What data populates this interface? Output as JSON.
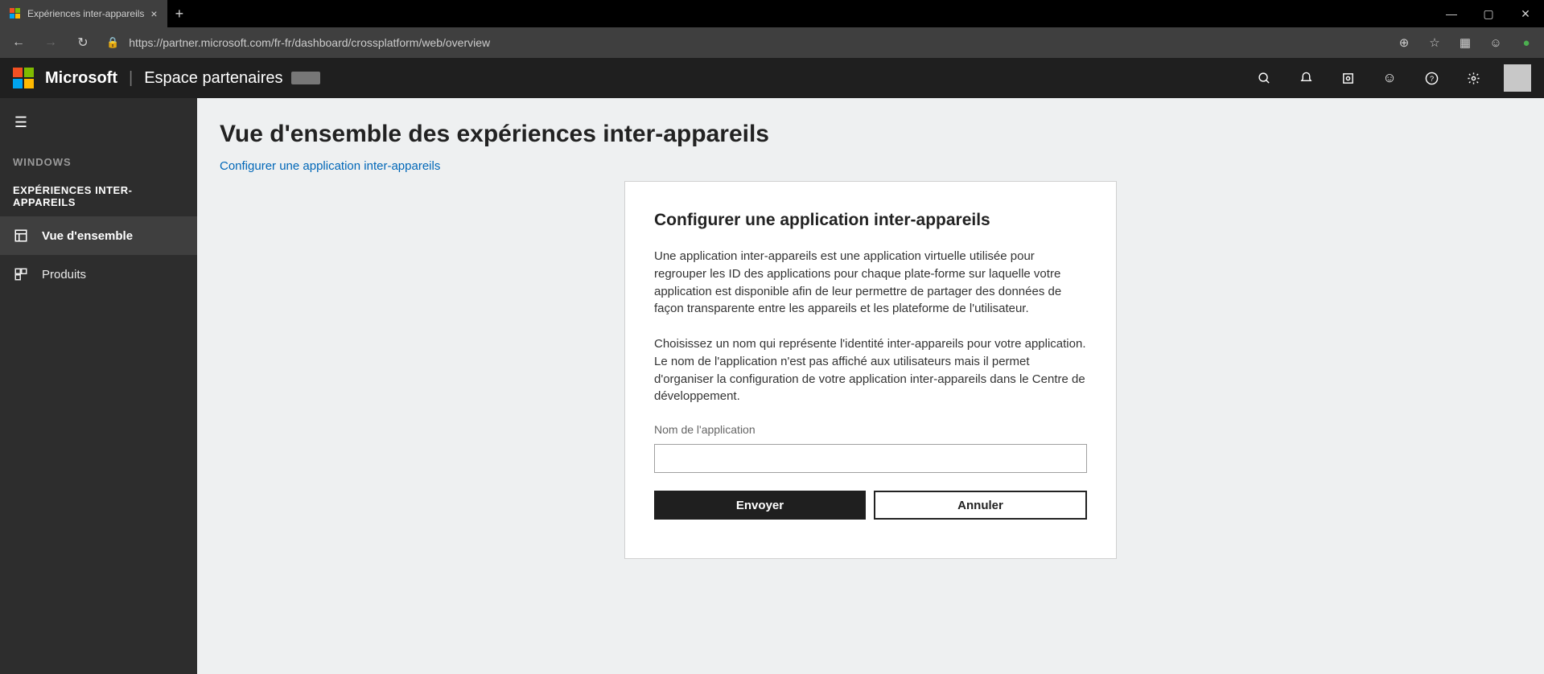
{
  "browser": {
    "tab_title": "Expériences inter-appareils",
    "url": "https://partner.microsoft.com/fr-fr/dashboard/crossplatform/web/overview"
  },
  "header": {
    "brand": "Microsoft",
    "portal": "Espace partenaires"
  },
  "sidebar": {
    "category": "WINDOWS",
    "section": "EXPÉRIENCES INTER-APPAREILS",
    "items": [
      {
        "label": "Vue d'ensemble"
      },
      {
        "label": "Produits"
      }
    ]
  },
  "page": {
    "title": "Vue d'ensemble des expériences inter-appareils",
    "config_link": "Configurer une application inter-appareils"
  },
  "dialog": {
    "title": "Configurer une application inter-appareils",
    "paragraph1": "Une application inter-appareils est une application virtuelle utilisée pour regrouper les ID des applications pour chaque plate-forme sur laquelle votre application est disponible afin de leur permettre de partager des données de façon transparente entre les appareils et les plateforme de l'utilisateur.",
    "paragraph2": "Choisissez un nom qui représente l'identité inter-appareils pour votre application. Le nom de l'application n'est pas affiché aux utilisateurs mais il permet d'organiser la configuration de votre application inter-appareils dans le Centre de développement.",
    "field_label": "Nom de l'application",
    "submit": "Envoyer",
    "cancel": "Annuler"
  }
}
